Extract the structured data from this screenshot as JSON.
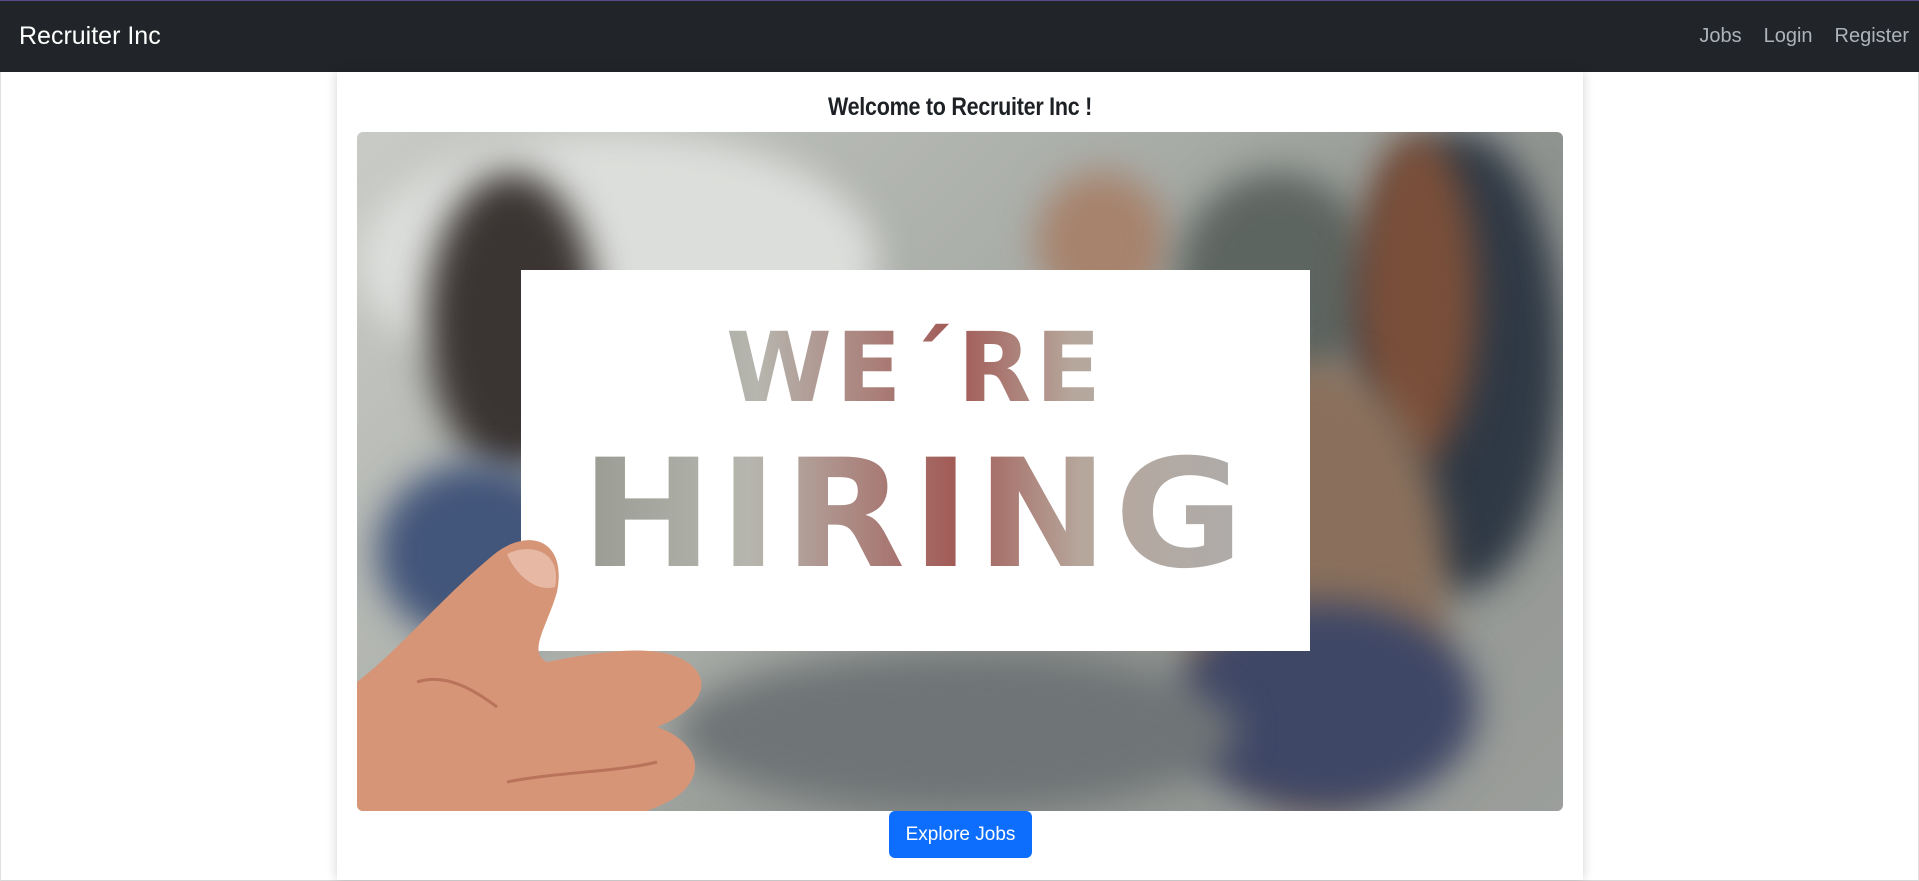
{
  "navbar": {
    "brand": "Recruiter Inc",
    "links": [
      "Jobs",
      "Login",
      "Register"
    ]
  },
  "main": {
    "welcome": "Welcome to Recruiter Inc !",
    "hero_sign_line1": "WE´RE",
    "hero_sign_line2": "HIRING",
    "explore_button": "Explore Jobs"
  },
  "colors": {
    "navbar_bg": "#212529",
    "nav_link": "#adb3b8",
    "button_primary": "#0d6efd"
  }
}
